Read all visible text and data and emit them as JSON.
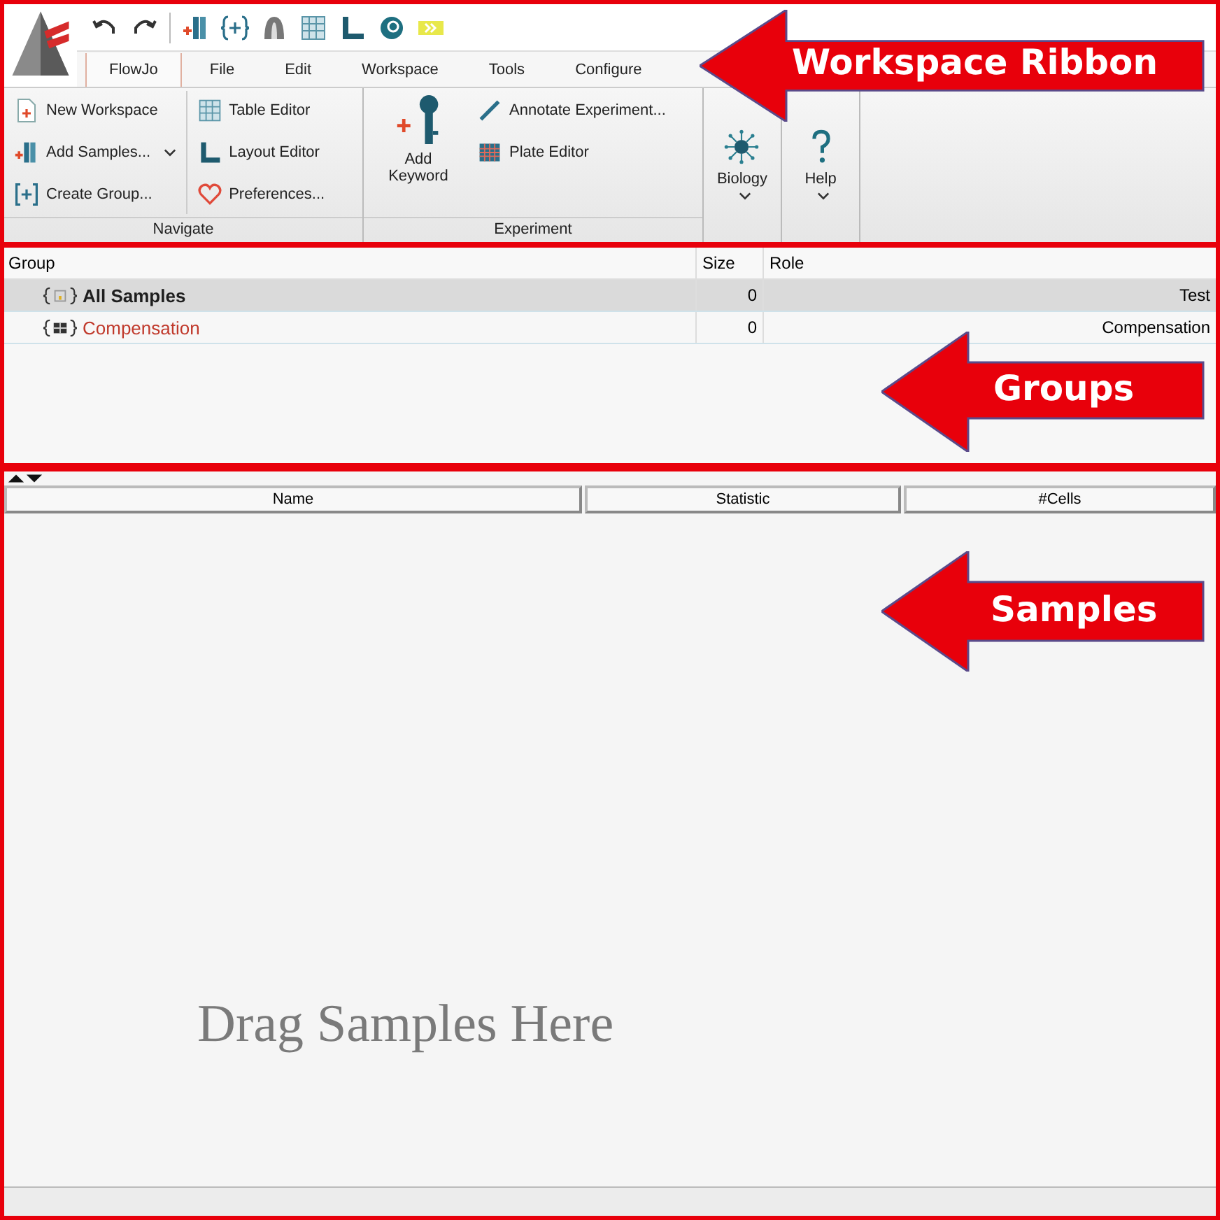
{
  "ribbon_tabs": [
    {
      "label": "FlowJo",
      "selected": true
    },
    {
      "label": "File",
      "selected": false
    },
    {
      "label": "Edit",
      "selected": false
    },
    {
      "label": "Workspace",
      "selected": false
    },
    {
      "label": "Tools",
      "selected": false
    },
    {
      "label": "Configure",
      "selected": false
    }
  ],
  "ribbon": {
    "navigate": {
      "label": "Navigate",
      "items": [
        "New Workspace",
        "Add Samples...",
        "Create Group...",
        "Table Editor",
        "Layout Editor",
        "Preferences..."
      ]
    },
    "experiment": {
      "label": "Experiment",
      "add_keyword": "Add Keyword",
      "items": [
        "Annotate Experiment...",
        "Plate Editor"
      ]
    },
    "biology": "Biology",
    "help": "Help"
  },
  "groups_table": {
    "columns": [
      "Group",
      "Size",
      "Role"
    ],
    "rows": [
      {
        "name": "All Samples",
        "size": "0",
        "role": "Test",
        "selected": true,
        "color": "#1e1e1e"
      },
      {
        "name": "Compensation",
        "size": "0",
        "role": "Compensation",
        "selected": false,
        "color": "#c0392b"
      }
    ]
  },
  "samples_table": {
    "columns": [
      "Name",
      "Statistic",
      "#Cells"
    ],
    "empty_message": "Drag Samples Here"
  },
  "callouts": [
    "Workspace Ribbon",
    "Groups",
    "Samples"
  ]
}
